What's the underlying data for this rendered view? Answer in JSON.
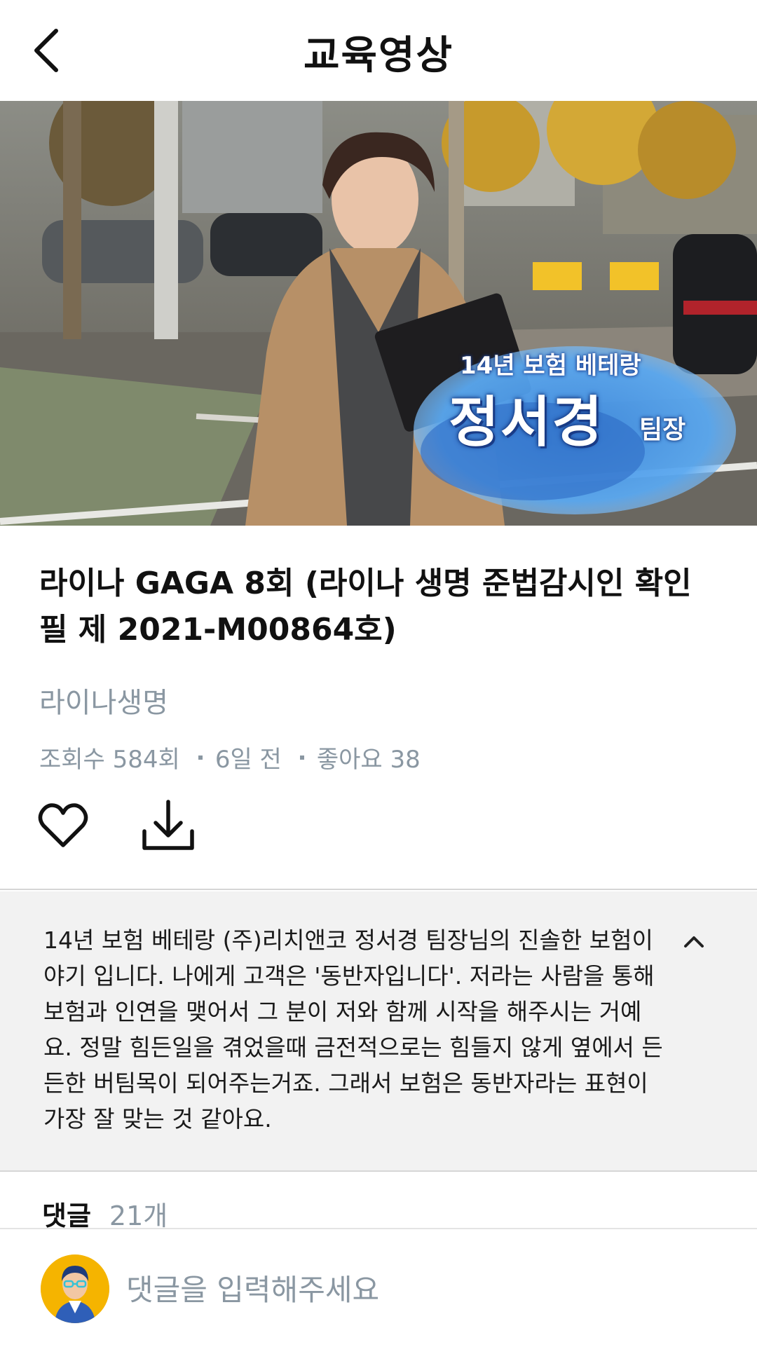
{
  "header": {
    "title": "교육영상"
  },
  "video": {
    "caption_line1": "14년 보험 베테랑",
    "caption_name": "정서경",
    "caption_role": "팀장"
  },
  "info": {
    "title": "라이나 GAGA 8회 (라이나 생명 준법감시인 확인필 제 2021-M00864호)",
    "channel": "라이나생명",
    "views": "조회수 584회",
    "date": "6일 전",
    "likes": "좋아요 38"
  },
  "description": "14년 보험 베테랑 (주)리치앤코 정서경 팀장님의 진솔한 보험이야기 입니다. 나에게 고객은 '동반자입니다'. 저라는 사람을 통해 보험과 인연을 맺어서 그 분이 저와 함께 시작을 해주시는 거예요. 정말 힘든일을 겪었을때 금전적으로는 힘들지 않게 옆에서 든든한 버팀목이 되어주는거죠. 그래서 보험은 동반자라는 표현이 가장 잘 맞는 것 같아요.",
  "comments": {
    "label": "댓글",
    "count": "21개",
    "placeholder": "댓글을 입력해주세요"
  },
  "icons": {
    "back": "chevron-left-icon",
    "like": "heart-icon",
    "download": "download-icon",
    "collapse": "chevron-up-icon",
    "avatar": "user-avatar"
  }
}
